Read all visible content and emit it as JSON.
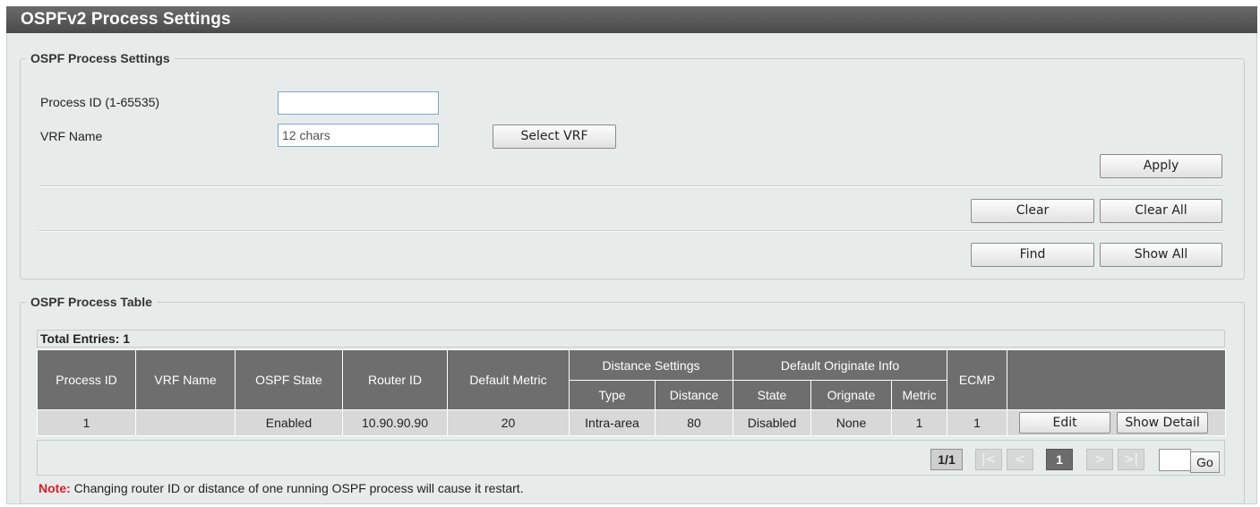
{
  "page": {
    "title": "OSPFv2 Process Settings"
  },
  "settings": {
    "legend": "OSPF Process Settings",
    "process_id_label": "Process ID (1-65535)",
    "process_id_value": "",
    "vrf_label": "VRF Name",
    "vrf_placeholder": "12 chars",
    "select_vrf_button": "Select VRF",
    "apply_button": "Apply",
    "clear_button": "Clear",
    "clear_all_button": "Clear All",
    "find_button": "Find",
    "show_all_button": "Show All"
  },
  "table": {
    "legend": "OSPF Process Table",
    "total_entries": "Total Entries: 1",
    "headers": {
      "process_id": "Process ID",
      "vrf_name": "VRF Name",
      "ospf_state": "OSPF State",
      "router_id": "Router ID",
      "default_metric": "Default Metric",
      "distance_settings": "Distance Settings",
      "distance_type": "Type",
      "distance": "Distance",
      "default_originate_info": "Default Originate Info",
      "orig_state": "State",
      "orig_originate": "Orignate",
      "orig_metric": "Metric",
      "ecmp": "ECMP"
    },
    "rows": [
      {
        "process_id": "1",
        "vrf_name": "",
        "ospf_state": "Enabled",
        "router_id": "10.90.90.90",
        "default_metric": "20",
        "type": "Intra-area",
        "distance": "80",
        "orig_state": "Disabled",
        "orig_originate": "None",
        "orig_metric": "1",
        "ecmp": "1",
        "edit_label": "Edit",
        "show_detail_label": "Show Detail"
      }
    ]
  },
  "pagination": {
    "page_count": "1/1",
    "first": "|<",
    "prev": "<",
    "current": "1",
    "next": ">",
    "last": ">|",
    "go_label": "Go"
  },
  "note": {
    "prefix": "Note:",
    "text": " Changing router ID or distance of one running OSPF process will cause it restart."
  },
  "colors": {
    "header_bg": "#6e6e6e",
    "panel_bg": "#e7ecea",
    "note_red": "#e31b23",
    "input_border": "#7ea6cf"
  }
}
